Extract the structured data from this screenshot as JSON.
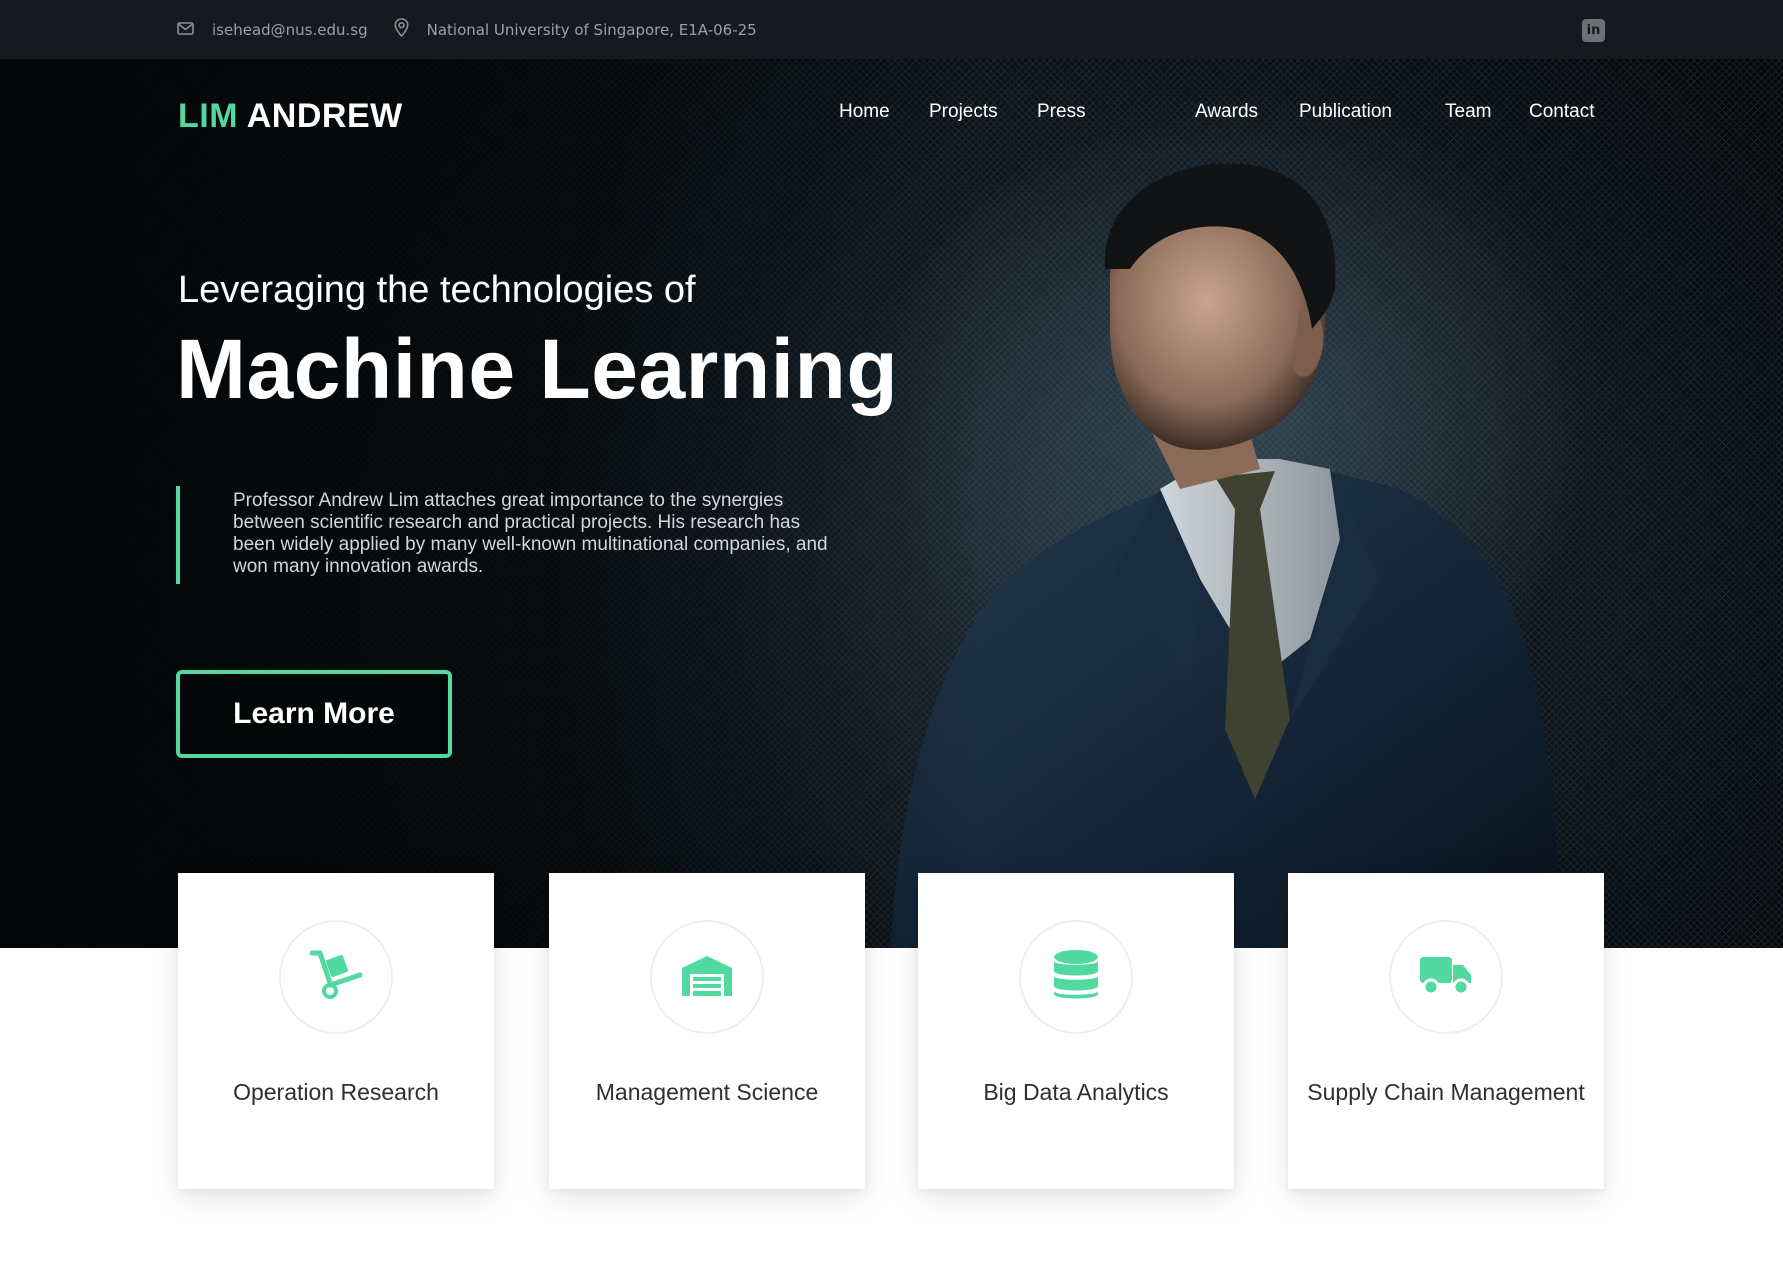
{
  "topbar": {
    "email": "isehead@nus.edu.sg",
    "address": "National University of Singapore, E1A-06-25",
    "icons": [
      "mail-icon",
      "location-pin-icon",
      "linkedin-icon"
    ],
    "linkedin_glyph": "in"
  },
  "header": {
    "logo_first": "LIM",
    "logo_second": "ANDREW",
    "nav": [
      "Home",
      "Projects",
      "Press",
      "Awards",
      "Publication",
      "Team",
      "Contact"
    ]
  },
  "hero": {
    "subhead": "Leveraging the technologies of",
    "headline": "Machine Learning",
    "description": "Professor Andrew Lim attaches great importance to the synergies between scientific research and practical projects. His research has been widely applied by many well-known multinational companies, and won many innovation awards.",
    "cta_label": "Learn More"
  },
  "cards": [
    {
      "icon": "hand-truck-icon",
      "title": "Operation Research"
    },
    {
      "icon": "warehouse-icon",
      "title": "Management Science"
    },
    {
      "icon": "database-icon",
      "title": "Big Data Analytics"
    },
    {
      "icon": "truck-icon",
      "title": "Supply Chain Management"
    }
  ],
  "colors": {
    "accent": "#52d9a0",
    "topbar_bg": "#161a1e",
    "hero_bg": "#0e161c",
    "card_text": "#2f2f2f"
  }
}
